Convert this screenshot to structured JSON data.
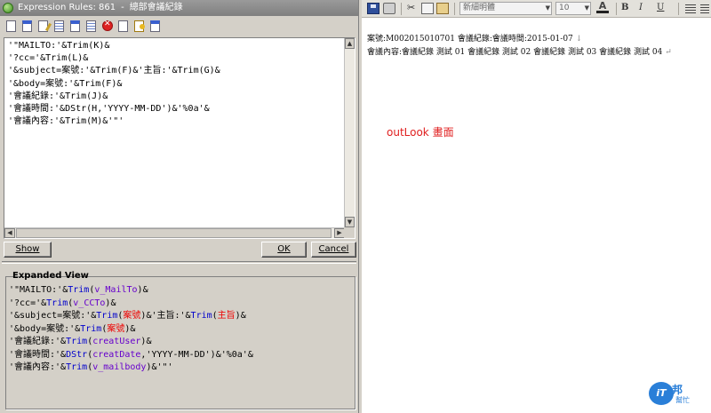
{
  "left_window": {
    "title_prefix": "Expression Rules: 861",
    "title_sep": "-",
    "title_name": "總部會議紀錄",
    "toolbar_icons": [
      "new-icon",
      "open-icon",
      "edit-icon",
      "table-icon",
      "window-icon",
      "grid-icon",
      "stop-icon",
      "document-icon",
      "key-icon",
      "properties-icon"
    ],
    "editor_lines": [
      "'\"MAILTO:'&Trim(K)&",
      "'?cc='&Trim(L)&",
      "'&subject=案號:'&Trim(F)&'主旨:'&Trim(G)&",
      "'&body=案號:'&Trim(F)&",
      "'會議紀錄:'&Trim(J)&",
      "'會議時間:'&DStr(H,'YYYY-MM-DD')&'%0a'&",
      "'會議內容:'&Trim(M)&'\"'"
    ],
    "buttons": {
      "show": "Show",
      "ok": "OK",
      "cancel": "Cancel"
    },
    "expanded_view": {
      "label": "Expanded View",
      "lines": [
        {
          "pre": "'\"MAILTO:'&",
          "fn": "Trim",
          "open": "(",
          "arg": "v_MailTo",
          "ref": "",
          "close": ")",
          "post": "&"
        },
        {
          "pre": "'?cc='&",
          "fn": "Trim",
          "open": "(",
          "arg": "v_CCTo",
          "ref": "",
          "close": ")",
          "post": "&"
        },
        {
          "pre": "'&subject=案號:'&",
          "fn": "Trim",
          "open": "(",
          "arg": "",
          "ref": "案號",
          "close": ")",
          "mid": "&'主旨:'&",
          "fn2": "Trim",
          "open2": "(",
          "ref2": "主旨",
          "close2": ")",
          "post": "&"
        },
        {
          "pre": "'&body=案號:'&",
          "fn": "Trim",
          "open": "(",
          "arg": "",
          "ref": "案號",
          "close": ")",
          "post": "&"
        },
        {
          "pre": "'會議紀錄:'&",
          "fn": "Trim",
          "open": "(",
          "arg": "creatUser",
          "ref": "",
          "close": ")",
          "post": "&"
        },
        {
          "pre": "'會議時間:'&",
          "fn": "DStr",
          "open": "(",
          "arg": "creatDate",
          "ref": "",
          "close": ",'YYYY-MM-DD')",
          "post": "&'%0a'&"
        },
        {
          "pre": "'會議內容:'&",
          "fn": "Trim",
          "open": "(",
          "arg": "v_mailbody",
          "ref": "",
          "close": ")",
          "post": "&'\"'"
        }
      ]
    }
  },
  "outlook": {
    "toolbar": {
      "font_name": "新細明體",
      "font_size": "10",
      "font_color_label": "A",
      "bold": "B",
      "italic": "I",
      "underline": "U",
      "cut": "✂"
    },
    "body_lines": [
      "案號:M002015010701 會議紀錄:會議時間:2015-01-07",
      "會議內容:會議紀錄 測試 01 會議紀錄 測試 02 會議紀錄 測試 03 會議紀錄 測試 04"
    ],
    "line_marks": [
      "↓",
      "↵"
    ],
    "annotation": "outLook 畫面",
    "annotation_color": "#e02020"
  },
  "watermark": {
    "logo_text": "iT",
    "name": "邦",
    "sub": "幫忙"
  }
}
